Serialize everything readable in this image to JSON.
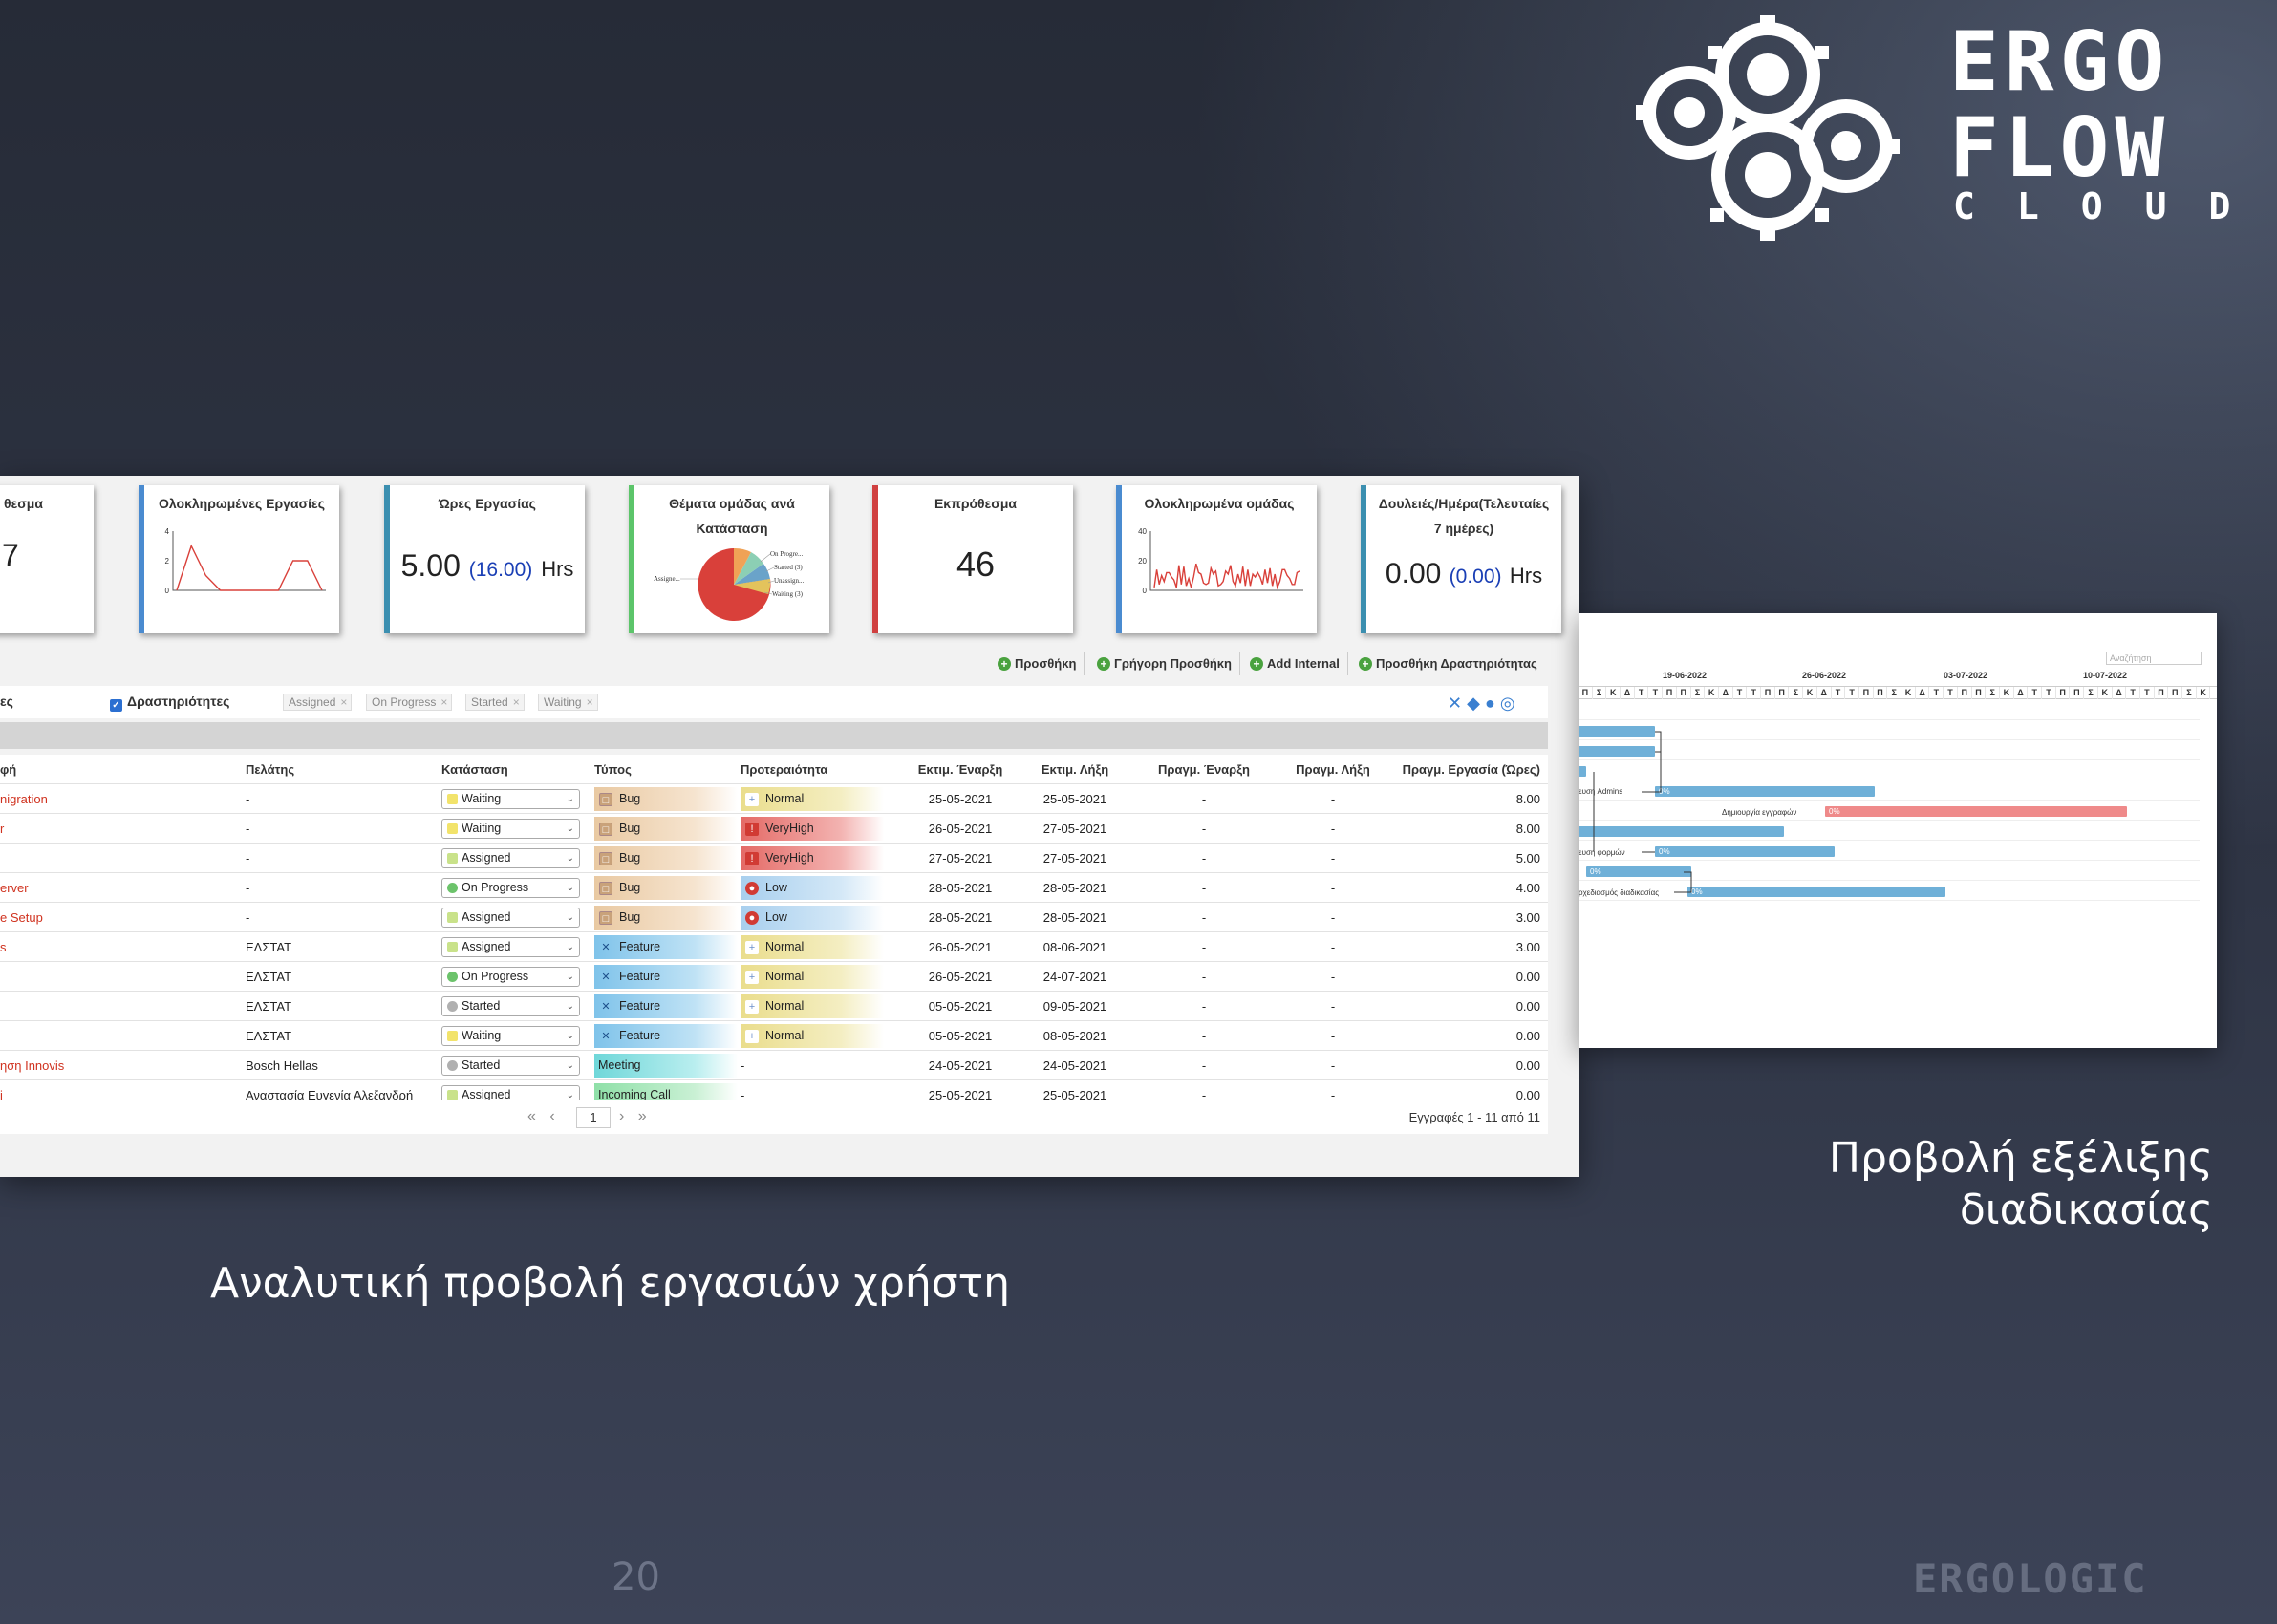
{
  "brand": {
    "line1": "ERGO",
    "line2": "FLOW",
    "line3": "CLOUD",
    "footer": "ERGOLOGIC",
    "color_white": "#ffffff"
  },
  "captions": {
    "left": "Αναλυτική προβολή εργασιών χρήστη",
    "right_line1": "Προβολή εξέλιξης",
    "right_line2": "διαδικασίας",
    "page_number": "20"
  },
  "cards": [
    {
      "title": "θεσμα",
      "value": "7",
      "color": "#888888"
    },
    {
      "title": "Ολοκληρωμένες Εργασίες",
      "color": "#4a8bd0",
      "chart_data": {
        "type": "line",
        "y": [
          0,
          3,
          1,
          0,
          0,
          0,
          0,
          0,
          2,
          2,
          0
        ],
        "ylim": [
          0,
          4
        ],
        "yticks": [
          "0",
          "2",
          "4"
        ]
      }
    },
    {
      "title": "Ώρες Εργασίας",
      "value": "5.00",
      "paren": "(16.00)",
      "unit": "Hrs",
      "color": "#3b8fb0"
    },
    {
      "title_line1": "Θέματα ομάδας ανά",
      "title_line2": "Κατάσταση",
      "color": "#5cc56a",
      "chart_data": {
        "type": "pie",
        "labels": [
          "Assigne...",
          "On Progre...",
          "Started (3)",
          "Unassign...",
          "Waiting (3)"
        ]
      }
    },
    {
      "title": "Εκπρόθεσμα",
      "value": "46",
      "color": "#d04040"
    },
    {
      "title": "Ολοκληρωμένα ομάδας",
      "color": "#4a8bd0",
      "chart_data": {
        "type": "line",
        "yticks": [
          "0",
          "20",
          "40"
        ],
        "ylim": [
          0,
          40
        ]
      }
    },
    {
      "title_line1": "Δουλειές/Ημέρα(Τελευταίες",
      "title_line2": "7 ημέρες)",
      "value": "0.00",
      "paren": "(0.00)",
      "unit": "Hrs",
      "color": "#3b8fb0"
    }
  ],
  "toolbar": {
    "add": "Προσθήκη",
    "quick_add": "Γρήγορη Προσθήκη",
    "add_internal": "Add Internal",
    "add_activity": "Προσθήκη Δραστηριότητας"
  },
  "filters": {
    "left_fragment": "ες",
    "activities_label": "Δραστηριότητες",
    "chips": [
      "Assigned",
      "On Progress",
      "Started",
      "Waiting"
    ]
  },
  "table": {
    "headers": {
      "title": "φή",
      "client": "Πελάτης",
      "status": "Κατάσταση",
      "type": "Τύπος",
      "priority": "Προτεραιότητα",
      "est_start": "Εκτιμ. Έναρξη",
      "est_end": "Εκτιμ. Λήξη",
      "real_start": "Πραγμ. Έναρξη",
      "real_end": "Πραγμ. Λήξη",
      "real_hours": "Πραγμ. Εργασία (Ώρες)"
    },
    "rows": [
      {
        "title": "nigration",
        "client": "-",
        "status": "Waiting",
        "type": "Bug",
        "priority": "Normal",
        "es": "25-05-2021",
        "ee": "25-05-2021",
        "rs": "-",
        "re": "-",
        "hrs": "8.00"
      },
      {
        "title": "r",
        "client": "-",
        "status": "Waiting",
        "type": "Bug",
        "priority": "VeryHigh",
        "es": "26-05-2021",
        "ee": "27-05-2021",
        "rs": "-",
        "re": "-",
        "hrs": "8.00"
      },
      {
        "title": "",
        "client": "-",
        "status": "Assigned",
        "type": "Bug",
        "priority": "VeryHigh",
        "es": "27-05-2021",
        "ee": "27-05-2021",
        "rs": "-",
        "re": "-",
        "hrs": "5.00"
      },
      {
        "title": "erver",
        "client": "-",
        "status": "On Progress",
        "type": "Bug",
        "priority": "Low",
        "es": "28-05-2021",
        "ee": "28-05-2021",
        "rs": "-",
        "re": "-",
        "hrs": "4.00"
      },
      {
        "title": "e Setup",
        "client": "-",
        "status": "Assigned",
        "type": "Bug",
        "priority": "Low",
        "es": "28-05-2021",
        "ee": "28-05-2021",
        "rs": "-",
        "re": "-",
        "hrs": "3.00"
      },
      {
        "title": "s",
        "client": "ΕΛΣΤΑΤ",
        "status": "Assigned",
        "type": "Feature",
        "priority": "Normal",
        "es": "26-05-2021",
        "ee": "08-06-2021",
        "rs": "-",
        "re": "-",
        "hrs": "3.00"
      },
      {
        "title": "",
        "client": "ΕΛΣΤΑΤ",
        "status": "On Progress",
        "type": "Feature",
        "priority": "Normal",
        "es": "26-05-2021",
        "ee": "24-07-2021",
        "rs": "-",
        "re": "-",
        "hrs": "0.00"
      },
      {
        "title": "",
        "client": "ΕΛΣΤΑΤ",
        "status": "Started",
        "type": "Feature",
        "priority": "Normal",
        "es": "05-05-2021",
        "ee": "09-05-2021",
        "rs": "-",
        "re": "-",
        "hrs": "0.00"
      },
      {
        "title": "",
        "client": "ΕΛΣΤΑΤ",
        "status": "Waiting",
        "type": "Feature",
        "priority": "Normal",
        "es": "05-05-2021",
        "ee": "08-05-2021",
        "rs": "-",
        "re": "-",
        "hrs": "0.00"
      },
      {
        "title": "ηση Innovis",
        "client": "Bosch Hellas",
        "status": "Started",
        "type": "Meeting",
        "priority": "-",
        "es": "24-05-2021",
        "ee": "24-05-2021",
        "rs": "-",
        "re": "-",
        "hrs": "0.00"
      },
      {
        "title": "j",
        "client": "Αναστασία Ευγενία Αλεξανδρή",
        "status": "Assigned",
        "type": "Incoming Call",
        "priority": "-",
        "es": "25-05-2021",
        "ee": "25-05-2021",
        "rs": "-",
        "re": "-",
        "hrs": "0.00"
      }
    ]
  },
  "pager": {
    "first": "«",
    "prev": "‹",
    "page": "1",
    "next": "›",
    "last": "»",
    "info": "Εγγραφές 1 - 11 από 11"
  },
  "status_colors": {
    "Waiting": "#f2e36b",
    "Assigned": "#c9e28a",
    "On Progress": "#6cc36b",
    "Started": "#b0b0b0"
  },
  "gantt": {
    "search_placeholder": "Αναζήτηση",
    "weeks": [
      "19-06-2022",
      "26-06-2022",
      "03-07-2022",
      "10-07-2022"
    ],
    "day_letters": [
      "Π",
      "Σ",
      "Κ",
      "Δ",
      "Τ",
      "Τ",
      "Π",
      "Π",
      "Σ",
      "Κ",
      "Δ",
      "Τ",
      "Τ",
      "Π",
      "Π",
      "Σ",
      "Κ",
      "Δ",
      "Τ",
      "Τ",
      "Π",
      "Π",
      "Σ",
      "Κ",
      "Δ",
      "Τ",
      "Τ",
      "Π",
      "Π",
      "Σ",
      "Κ",
      "Δ",
      "Τ",
      "Τ",
      "Π",
      "Π",
      "Σ",
      "Κ",
      "Δ",
      "Τ",
      "Τ",
      "Π",
      "Π",
      "Σ",
      "Κ"
    ],
    "labels": [
      "ευση Admins",
      "Δημιουργία εγγραφών",
      "ευση φορμών",
      "ρχεδιασμός διαδικασίας"
    ],
    "pct": "0%"
  }
}
